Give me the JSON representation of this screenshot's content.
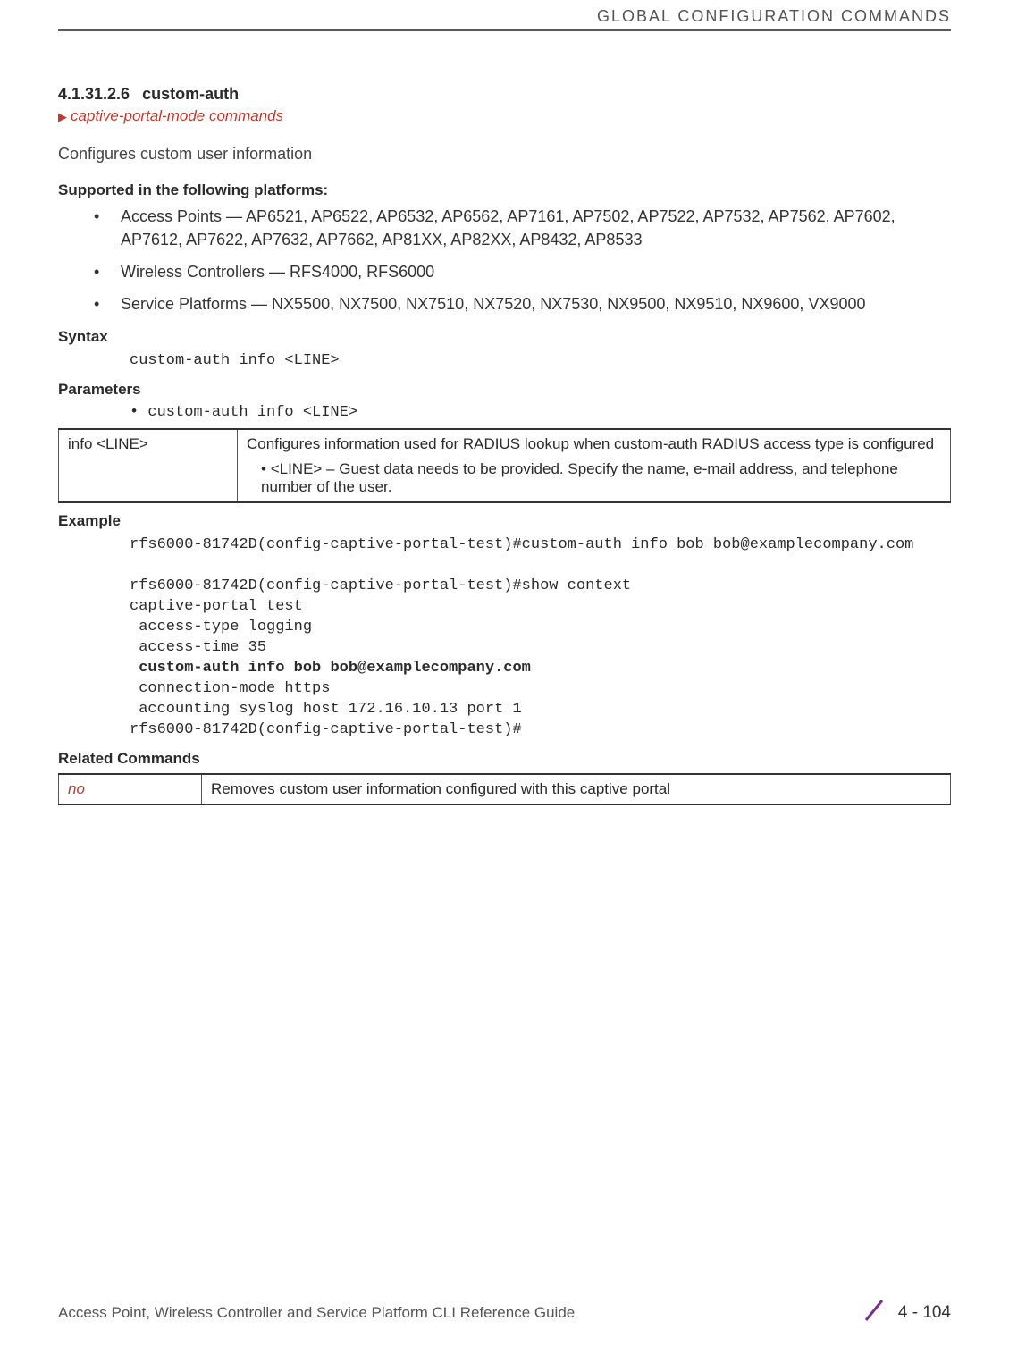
{
  "header": {
    "category": "GLOBAL CONFIGURATION COMMANDS"
  },
  "section": {
    "number": "4.1.31.2.6",
    "title": "custom-auth",
    "breadcrumb": "captive-portal-mode commands",
    "description": "Configures custom user information"
  },
  "supported": {
    "heading": "Supported in the following platforms:",
    "items": [
      "Access Points — AP6521, AP6522, AP6532, AP6562, AP7161, AP7502, AP7522, AP7532, AP7562, AP7602, AP7612, AP7622, AP7632, AP7662, AP81XX, AP82XX, AP8432, AP8533",
      "Wireless Controllers — RFS4000, RFS6000",
      "Service Platforms — NX5500, NX7500, NX7510, NX7520, NX7530, NX9500, NX9510, NX9600, VX9000"
    ]
  },
  "syntax": {
    "heading": "Syntax",
    "code": "custom-auth info <LINE>"
  },
  "parameters": {
    "heading": "Parameters",
    "bullet": "• custom-auth info <LINE>",
    "table": {
      "col1": "info <LINE>",
      "col2_main": "Configures information used for RADIUS lookup when custom-auth RADIUS access type is configured",
      "col2_bullet": "<LINE> – Guest data needs to be provided. Specify the name, e-mail address, and telephone number of the user."
    }
  },
  "example": {
    "heading": "Example",
    "code_pre": "rfs6000-81742D(config-captive-portal-test)#custom-auth info bob bob@examplecompany.com\n\nrfs6000-81742D(config-captive-portal-test)#show context\ncaptive-portal test\n access-type logging\n access-time 35\n ",
    "code_bold": "custom-auth info bob bob@examplecompany.com",
    "code_post": "\n connection-mode https\n accounting syslog host 172.16.10.13 port 1\nrfs6000-81742D(config-captive-portal-test)#"
  },
  "related": {
    "heading": "Related Commands",
    "col1": "no",
    "col2": "Removes custom user information configured with this captive portal"
  },
  "footer": {
    "guide": "Access Point, Wireless Controller and Service Platform CLI Reference Guide",
    "page": "4 - 104"
  }
}
